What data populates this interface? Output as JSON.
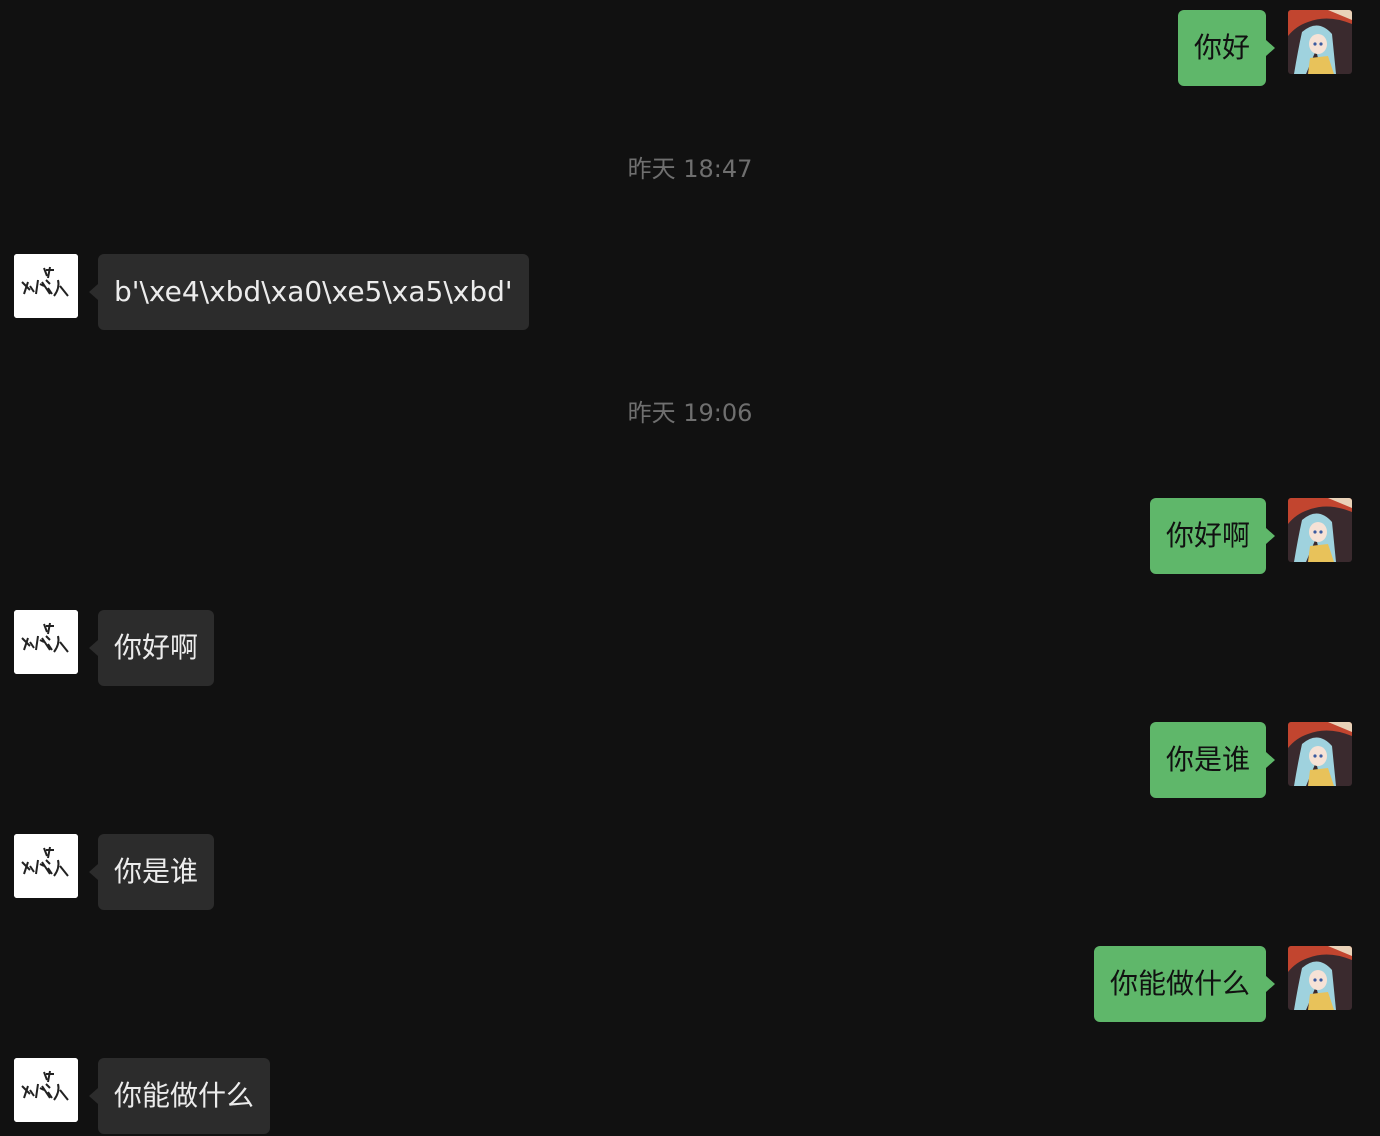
{
  "messages": [
    {
      "side": "user",
      "text": "你好"
    },
    {
      "side": "time",
      "text": "昨天 18:47"
    },
    {
      "side": "bot",
      "text": "b'\\xe4\\xbd\\xa0\\xe5\\xa5\\xbd'"
    },
    {
      "side": "time",
      "text": "昨天 19:06"
    },
    {
      "side": "user",
      "text": "你好啊"
    },
    {
      "side": "bot",
      "text": "你好啊"
    },
    {
      "side": "user",
      "text": "你是谁"
    },
    {
      "side": "bot",
      "text": "你是谁"
    },
    {
      "side": "user",
      "text": "你能做什么"
    },
    {
      "side": "bot",
      "text": "你能做什么"
    }
  ],
  "avatars": {
    "user": {
      "icon": "anime-character-avatar-icon"
    },
    "bot": {
      "icon": "ai-logo-avatar-icon",
      "logo_text": "AI 放晟人"
    }
  },
  "colors": {
    "background": "#111111",
    "user_bubble": "#5fb76a",
    "bot_bubble": "#2c2c2c",
    "timestamp": "#6f6f6f"
  }
}
